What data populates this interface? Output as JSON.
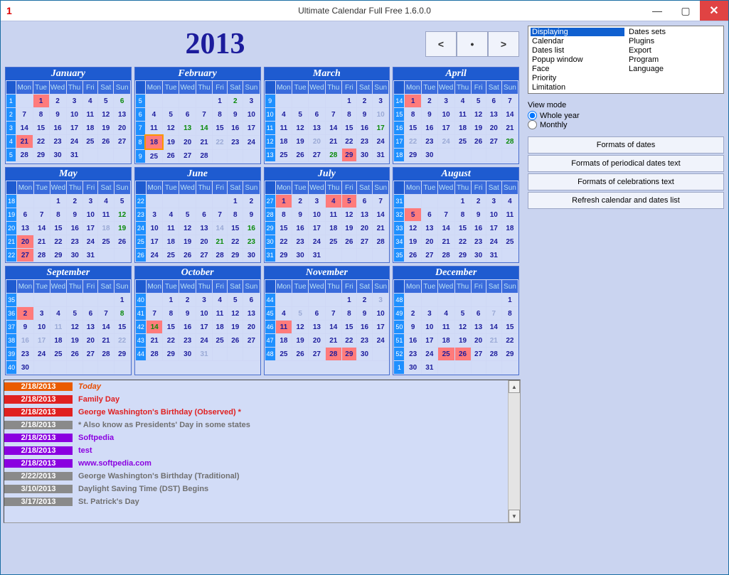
{
  "window": {
    "corner": "1",
    "title": "Ultimate Calendar Full Free 1.6.0.0"
  },
  "year": "2013",
  "nav": {
    "prev": "<",
    "today": "•",
    "next": ">"
  },
  "dow": [
    "Mon",
    "Tue",
    "Wed",
    "Thu",
    "Fri",
    "Sat",
    "Sun"
  ],
  "months": [
    {
      "name": "January",
      "weeks": [
        {
          "w": "1",
          "d": [
            "",
            "1",
            "2",
            "3",
            "4",
            "5",
            "6"
          ]
        },
        {
          "w": "2",
          "d": [
            "7",
            "8",
            "9",
            "10",
            "11",
            "12",
            "13"
          ]
        },
        {
          "w": "3",
          "d": [
            "14",
            "15",
            "16",
            "17",
            "18",
            "19",
            "20"
          ]
        },
        {
          "w": "4",
          "d": [
            "21",
            "22",
            "23",
            "24",
            "25",
            "26",
            "27"
          ]
        },
        {
          "w": "5",
          "d": [
            "28",
            "29",
            "30",
            "31",
            "",
            "",
            ""
          ]
        }
      ],
      "red": [
        "1",
        "21"
      ],
      "grn": [
        "6"
      ]
    },
    {
      "name": "February",
      "weeks": [
        {
          "w": "5",
          "d": [
            "",
            "",
            "",
            "",
            "1",
            "2",
            "3"
          ]
        },
        {
          "w": "6",
          "d": [
            "4",
            "5",
            "6",
            "7",
            "8",
            "9",
            "10"
          ]
        },
        {
          "w": "7",
          "d": [
            "11",
            "12",
            "13",
            "14",
            "15",
            "16",
            "17"
          ]
        },
        {
          "w": "8",
          "d": [
            "18",
            "19",
            "20",
            "21",
            "22",
            "23",
            "24"
          ]
        },
        {
          "w": "9",
          "d": [
            "25",
            "26",
            "27",
            "28",
            "",
            "",
            ""
          ]
        }
      ],
      "red": [],
      "grn": [
        "2",
        "13",
        "14"
      ],
      "dim": [
        "22"
      ],
      "today": "18"
    },
    {
      "name": "March",
      "weeks": [
        {
          "w": "9",
          "d": [
            "",
            "",
            "",
            "",
            "1",
            "2",
            "3"
          ]
        },
        {
          "w": "10",
          "d": [
            "4",
            "5",
            "6",
            "7",
            "8",
            "9",
            "10"
          ]
        },
        {
          "w": "11",
          "d": [
            "11",
            "12",
            "13",
            "14",
            "15",
            "16",
            "17"
          ]
        },
        {
          "w": "12",
          "d": [
            "18",
            "19",
            "20",
            "21",
            "22",
            "23",
            "24"
          ]
        },
        {
          "w": "13",
          "d": [
            "25",
            "26",
            "27",
            "28",
            "29",
            "30",
            "31"
          ]
        }
      ],
      "red": [
        "29"
      ],
      "grn": [
        "17",
        "28"
      ],
      "dim": [
        "10",
        "20"
      ]
    },
    {
      "name": "April",
      "weeks": [
        {
          "w": "14",
          "d": [
            "1",
            "2",
            "3",
            "4",
            "5",
            "6",
            "7"
          ]
        },
        {
          "w": "15",
          "d": [
            "8",
            "9",
            "10",
            "11",
            "12",
            "13",
            "14"
          ]
        },
        {
          "w": "16",
          "d": [
            "15",
            "16",
            "17",
            "18",
            "19",
            "20",
            "21"
          ]
        },
        {
          "w": "17",
          "d": [
            "22",
            "23",
            "24",
            "25",
            "26",
            "27",
            "28"
          ]
        },
        {
          "w": "18",
          "d": [
            "29",
            "30",
            "",
            "",
            "",
            "",
            ""
          ]
        }
      ],
      "red": [
        "1"
      ],
      "grn": [
        "28"
      ],
      "dim": [
        "22",
        "24"
      ]
    },
    {
      "name": "May",
      "weeks": [
        {
          "w": "18",
          "d": [
            "",
            "",
            "1",
            "2",
            "3",
            "4",
            "5"
          ]
        },
        {
          "w": "19",
          "d": [
            "6",
            "7",
            "8",
            "9",
            "10",
            "11",
            "12"
          ]
        },
        {
          "w": "20",
          "d": [
            "13",
            "14",
            "15",
            "16",
            "17",
            "18",
            "19"
          ]
        },
        {
          "w": "21",
          "d": [
            "20",
            "21",
            "22",
            "23",
            "24",
            "25",
            "26"
          ]
        },
        {
          "w": "22",
          "d": [
            "27",
            "28",
            "29",
            "30",
            "31",
            "",
            ""
          ]
        }
      ],
      "red": [
        "20",
        "27"
      ],
      "grn": [
        "12",
        "19"
      ],
      "dim": [
        "18"
      ]
    },
    {
      "name": "June",
      "weeks": [
        {
          "w": "22",
          "d": [
            "",
            "",
            "",
            "",
            "",
            "1",
            "2"
          ]
        },
        {
          "w": "23",
          "d": [
            "3",
            "4",
            "5",
            "6",
            "7",
            "8",
            "9"
          ]
        },
        {
          "w": "24",
          "d": [
            "10",
            "11",
            "12",
            "13",
            "14",
            "15",
            "16"
          ]
        },
        {
          "w": "25",
          "d": [
            "17",
            "18",
            "19",
            "20",
            "21",
            "22",
            "23"
          ]
        },
        {
          "w": "26",
          "d": [
            "24",
            "25",
            "26",
            "27",
            "28",
            "29",
            "30"
          ]
        }
      ],
      "red": [],
      "grn": [
        "16",
        "21",
        "23"
      ],
      "dim": [
        "14"
      ]
    },
    {
      "name": "July",
      "weeks": [
        {
          "w": "27",
          "d": [
            "1",
            "2",
            "3",
            "4",
            "5",
            "6",
            "7"
          ]
        },
        {
          "w": "28",
          "d": [
            "8",
            "9",
            "10",
            "11",
            "12",
            "13",
            "14"
          ]
        },
        {
          "w": "29",
          "d": [
            "15",
            "16",
            "17",
            "18",
            "19",
            "20",
            "21"
          ]
        },
        {
          "w": "30",
          "d": [
            "22",
            "23",
            "24",
            "25",
            "26",
            "27",
            "28"
          ]
        },
        {
          "w": "31",
          "d": [
            "29",
            "30",
            "31",
            "",
            "",
            "",
            ""
          ]
        }
      ],
      "red": [
        "1",
        "4",
        "5"
      ],
      "grn": []
    },
    {
      "name": "August",
      "weeks": [
        {
          "w": "31",
          "d": [
            "",
            "",
            "",
            "1",
            "2",
            "3",
            "4"
          ]
        },
        {
          "w": "32",
          "d": [
            "5",
            "6",
            "7",
            "8",
            "9",
            "10",
            "11"
          ]
        },
        {
          "w": "33",
          "d": [
            "12",
            "13",
            "14",
            "15",
            "16",
            "17",
            "18"
          ]
        },
        {
          "w": "34",
          "d": [
            "19",
            "20",
            "21",
            "22",
            "23",
            "24",
            "25"
          ]
        },
        {
          "w": "35",
          "d": [
            "26",
            "27",
            "28",
            "29",
            "30",
            "31",
            ""
          ]
        }
      ],
      "red": [
        "5"
      ],
      "grn": []
    },
    {
      "name": "September",
      "weeks": [
        {
          "w": "35",
          "d": [
            "",
            "",
            "",
            "",
            "",
            "",
            "1"
          ]
        },
        {
          "w": "36",
          "d": [
            "2",
            "3",
            "4",
            "5",
            "6",
            "7",
            "8"
          ]
        },
        {
          "w": "37",
          "d": [
            "9",
            "10",
            "11",
            "12",
            "13",
            "14",
            "15"
          ]
        },
        {
          "w": "38",
          "d": [
            "16",
            "17",
            "18",
            "19",
            "20",
            "21",
            "22"
          ]
        },
        {
          "w": "39",
          "d": [
            "23",
            "24",
            "25",
            "26",
            "27",
            "28",
            "29"
          ]
        },
        {
          "w": "40",
          "d": [
            "30",
            "",
            "",
            "",
            "",
            "",
            ""
          ]
        }
      ],
      "red": [
        "2"
      ],
      "grn": [
        "8"
      ],
      "dim": [
        "11",
        "16",
        "17",
        "22"
      ]
    },
    {
      "name": "October",
      "weeks": [
        {
          "w": "40",
          "d": [
            "",
            "1",
            "2",
            "3",
            "4",
            "5",
            "6"
          ]
        },
        {
          "w": "41",
          "d": [
            "7",
            "8",
            "9",
            "10",
            "11",
            "12",
            "13"
          ]
        },
        {
          "w": "42",
          "d": [
            "14",
            "15",
            "16",
            "17",
            "18",
            "19",
            "20"
          ]
        },
        {
          "w": "43",
          "d": [
            "21",
            "22",
            "23",
            "24",
            "25",
            "26",
            "27"
          ]
        },
        {
          "w": "44",
          "d": [
            "28",
            "29",
            "30",
            "31",
            "",
            "",
            ""
          ]
        }
      ],
      "red": [
        "14"
      ],
      "grn": [
        "14"
      ],
      "dim": [
        "31"
      ]
    },
    {
      "name": "November",
      "weeks": [
        {
          "w": "44",
          "d": [
            "",
            "",
            "",
            "",
            "1",
            "2",
            "3"
          ]
        },
        {
          "w": "45",
          "d": [
            "4",
            "5",
            "6",
            "7",
            "8",
            "9",
            "10"
          ]
        },
        {
          "w": "46",
          "d": [
            "11",
            "12",
            "13",
            "14",
            "15",
            "16",
            "17"
          ]
        },
        {
          "w": "47",
          "d": [
            "18",
            "19",
            "20",
            "21",
            "22",
            "23",
            "24"
          ]
        },
        {
          "w": "48",
          "d": [
            "25",
            "26",
            "27",
            "28",
            "29",
            "30",
            ""
          ]
        }
      ],
      "red": [
        "11",
        "28",
        "29"
      ],
      "grn": [],
      "dim": [
        "3",
        "5"
      ]
    },
    {
      "name": "December",
      "weeks": [
        {
          "w": "48",
          "d": [
            "",
            "",
            "",
            "",
            "",
            "",
            "1"
          ]
        },
        {
          "w": "49",
          "d": [
            "2",
            "3",
            "4",
            "5",
            "6",
            "7",
            "8"
          ]
        },
        {
          "w": "50",
          "d": [
            "9",
            "10",
            "11",
            "12",
            "13",
            "14",
            "15"
          ]
        },
        {
          "w": "51",
          "d": [
            "16",
            "17",
            "18",
            "19",
            "20",
            "21",
            "22"
          ]
        },
        {
          "w": "52",
          "d": [
            "23",
            "24",
            "25",
            "26",
            "27",
            "28",
            "29"
          ]
        },
        {
          "w": "1",
          "d": [
            "30",
            "31",
            "",
            "",
            "",
            "",
            ""
          ]
        }
      ],
      "red": [
        "25",
        "26"
      ],
      "grn": [],
      "dim": [
        "7",
        "21"
      ]
    }
  ],
  "events": [
    {
      "date": "2/18/2013",
      "text": "Today",
      "dbg": "#EA5B00",
      "tcol": "#E74C00",
      "style": "italic"
    },
    {
      "date": "2/18/2013",
      "text": "Family Day",
      "dbg": "#E02020",
      "tcol": "#E02020"
    },
    {
      "date": "2/18/2013",
      "text": "George Washington's Birthday (Observed) *",
      "dbg": "#E02020",
      "tcol": "#E02020"
    },
    {
      "date": "2/18/2013",
      "text": "* Also know as Presidents' Day in some states",
      "dbg": "#8A8A8A",
      "tcol": "#707070"
    },
    {
      "date": "2/18/2013",
      "text": "Softpedia",
      "dbg": "#8A00E0",
      "tcol": "#8A00E0"
    },
    {
      "date": "2/18/2013",
      "text": "test",
      "dbg": "#8A00E0",
      "tcol": "#8A00E0"
    },
    {
      "date": "2/18/2013",
      "text": "www.softpedia.com",
      "dbg": "#8A00E0",
      "tcol": "#8A00E0"
    },
    {
      "date": "2/22/2013",
      "text": "George Washington's Birthday (Traditional)",
      "dbg": "#8A8A8A",
      "tcol": "#707070"
    },
    {
      "date": "3/10/2013",
      "text": "Daylight Saving Time (DST) Begins",
      "dbg": "#8A8A8A",
      "tcol": "#707070"
    },
    {
      "date": "3/17/2013",
      "text": "St. Patrick's Day",
      "dbg": "#8A8A8A",
      "tcol": "#707070"
    }
  ],
  "props": {
    "col1": [
      "Displaying",
      "Calendar",
      "Dates list",
      "Popup window",
      "Face",
      "Priority",
      "Limitation"
    ],
    "col2": [
      "Dates sets",
      "Plugins",
      "Export",
      "Program",
      "Language"
    ],
    "selected": "Displaying"
  },
  "viewmode": {
    "label": "View mode",
    "whole": "Whole year",
    "monthly": "Monthly",
    "selected": "whole"
  },
  "buttons": {
    "b1": "Formats of dates",
    "b2": "Formats of periodical dates text",
    "b3": "Formats of celebrations text",
    "b4": "Refresh calendar and dates list"
  }
}
